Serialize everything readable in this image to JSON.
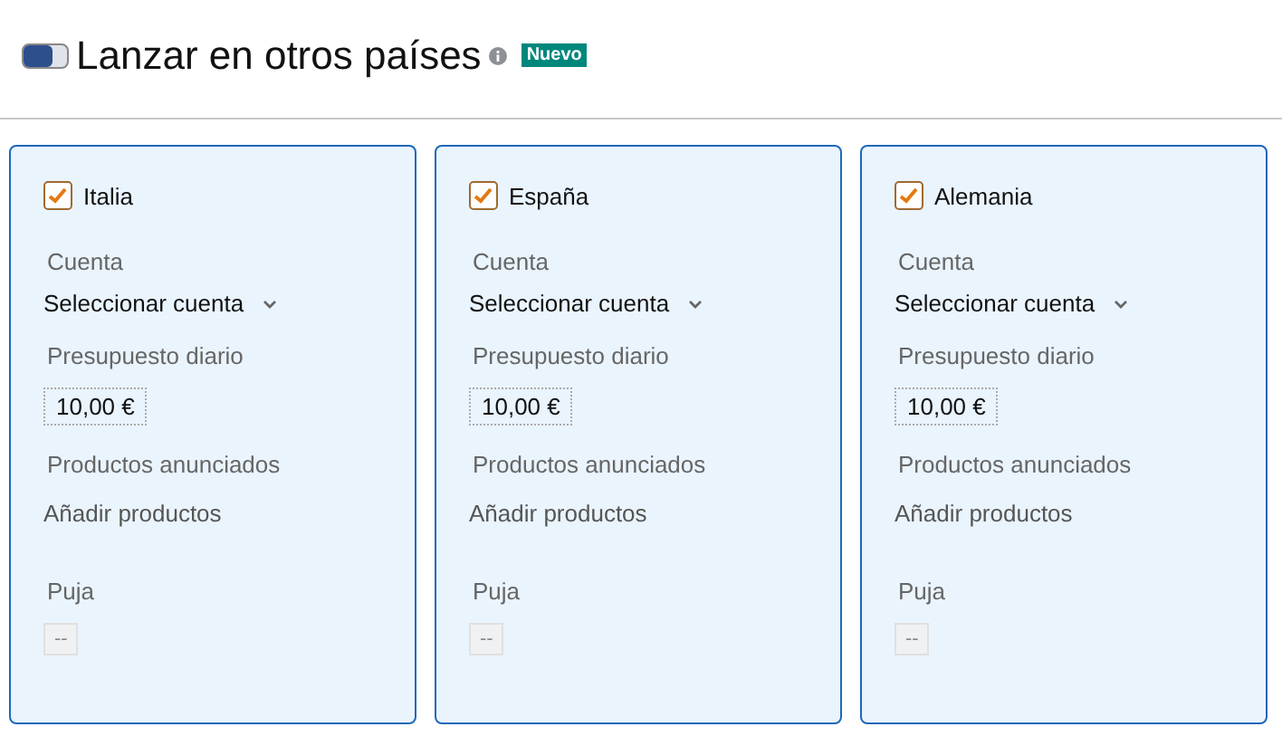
{
  "header": {
    "toggle": {
      "on": true
    },
    "title": "Lanzar en otros países",
    "badge": "Nuevo"
  },
  "countries": [
    {
      "name": "Italia",
      "checked": true,
      "account_label": "Cuenta",
      "account_value": "Seleccionar cuenta",
      "budget_label": "Presupuesto diario",
      "budget_value": "10,00 €",
      "products_label": "Productos anunciados",
      "products_link": "Añadir productos",
      "bid_label": "Puja",
      "bid_value": "--"
    },
    {
      "name": "España",
      "checked": true,
      "account_label": "Cuenta",
      "account_value": "Seleccionar cuenta",
      "budget_label": "Presupuesto diario",
      "budget_value": "10,00 €",
      "products_label": "Productos anunciados",
      "products_link": "Añadir productos",
      "bid_label": "Puja",
      "bid_value": "--"
    },
    {
      "name": "Alemania",
      "checked": true,
      "account_label": "Cuenta",
      "account_value": "Seleccionar cuenta",
      "budget_label": "Presupuesto diario",
      "budget_value": "10,00 €",
      "products_label": "Productos anunciados",
      "products_link": "Añadir productos",
      "bid_label": "Puja",
      "bid_value": "--"
    }
  ]
}
